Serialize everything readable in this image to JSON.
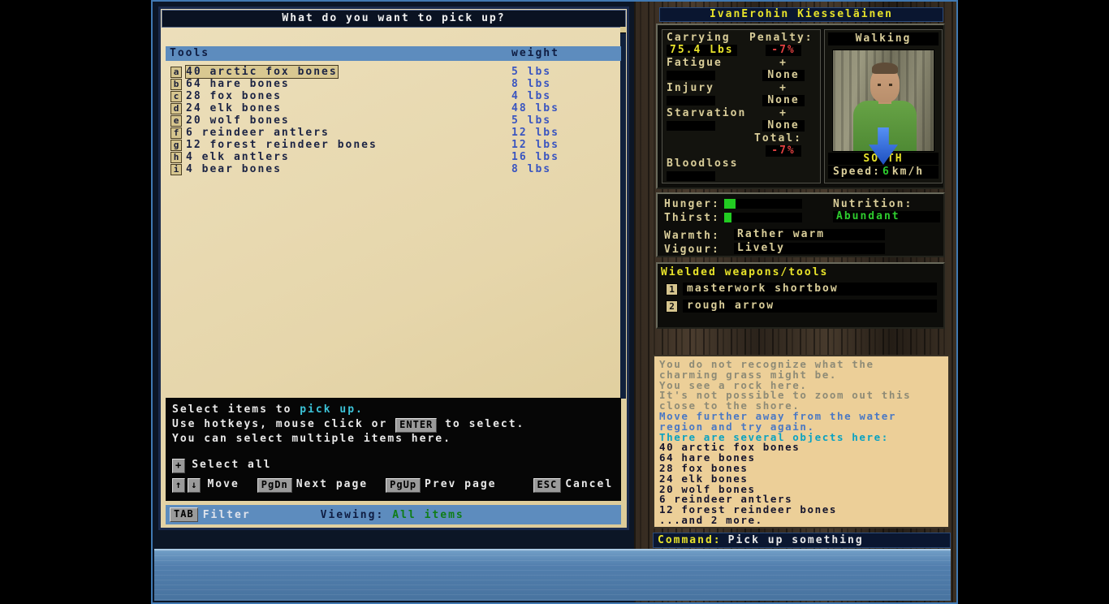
{
  "colors": {
    "header_blue": "#5d8cbe",
    "parchment": "#e6d6ab",
    "weight_blue": "#3a55c0",
    "penalty_red": "#e04040",
    "accent_yellow": "#e8e32a",
    "good_green": "#2ecc2e",
    "highlight_cyan": "#3cc3d8",
    "log_tan": "#eccf98"
  },
  "dialog": {
    "title": "What do you want to pick up?",
    "list_header": {
      "category": "Tools",
      "weight_col": "weight"
    },
    "items": [
      {
        "key": "a",
        "name": "40 arctic fox bones",
        "weight": "5 lbs",
        "selected": true
      },
      {
        "key": "b",
        "name": "64 hare bones",
        "weight": "8 lbs",
        "selected": false
      },
      {
        "key": "c",
        "name": "28 fox bones",
        "weight": "4 lbs",
        "selected": false
      },
      {
        "key": "d",
        "name": "24 elk bones",
        "weight": "48 lbs",
        "selected": false
      },
      {
        "key": "e",
        "name": "20 wolf bones",
        "weight": "5 lbs",
        "selected": false
      },
      {
        "key": "f",
        "name": "6 reindeer antlers",
        "weight": "12 lbs",
        "selected": false
      },
      {
        "key": "g",
        "name": "12 forest reindeer bones",
        "weight": "12 lbs",
        "selected": false
      },
      {
        "key": "h",
        "name": "4 elk antlers",
        "weight": "16 lbs",
        "selected": false
      },
      {
        "key": "i",
        "name": "4 bear bones",
        "weight": "8 lbs",
        "selected": false
      }
    ],
    "help": {
      "line1_prefix": "Select items to ",
      "line1_highlight": "pick up.",
      "line2_prefix": "Use hotkeys, mouse click or ",
      "line2_key": "ENTER",
      "line2_suffix": " to select.",
      "line3": "You can select multiple items here.",
      "select_all_key": "+",
      "select_all_label": "Select all",
      "up_key": "↑",
      "down_key": "↓",
      "move_label": "Move",
      "pgdn_key": "PgDn",
      "pgdn_label": "Next page",
      "pgup_key": "PgUp",
      "pgup_label": "Prev page",
      "esc_key": "ESC",
      "esc_label": "Cancel"
    },
    "filter_bar": {
      "tab_key": "TAB",
      "filter_label": "Filter",
      "viewing_label": "Viewing:",
      "viewing_value": "All items"
    }
  },
  "character": {
    "name": "IvanErohin Kiesseläinen",
    "carrying_label": "Carrying",
    "carrying_value": "75.4 Lbs",
    "penalty_label": "Penalty:",
    "penalty_value": "-7%",
    "fatigue_label": "Fatigue",
    "injury_label": "Injury",
    "starvation_label": "Starvation",
    "bloodloss_label": "Bloodloss",
    "plus": "+",
    "none_value": "None",
    "total_label": "Total:",
    "total_value": "-7%",
    "movement_mode": "Walking",
    "direction": "SOUTH",
    "speed_label": "Speed:",
    "speed_value": "6",
    "speed_unit": "km/h"
  },
  "vitals": {
    "hunger_label": "Hunger:",
    "hunger_fill": 15,
    "thirst_label": "Thirst:",
    "thirst_fill": 9,
    "nutrition_label": "Nutrition:",
    "nutrition_value": "Abundant",
    "warmth_label": "Warmth:",
    "warmth_value": "Rather warm",
    "vigour_label": "Vigour:",
    "vigour_value": "Lively"
  },
  "wielded": {
    "title": "Wielded weapons/tools",
    "slots": [
      {
        "key": "1",
        "name": "masterwork shortbow"
      },
      {
        "key": "2",
        "name": "rough arrow"
      }
    ]
  },
  "log": {
    "lines": [
      {
        "text": "You do not recognize what the",
        "tone": "gray"
      },
      {
        "text": "charming grass might be.",
        "tone": "gray"
      },
      {
        "text": "You see a rock here.",
        "tone": "gray"
      },
      {
        "text": "It's not possible to zoom out this",
        "tone": "gray"
      },
      {
        "text": "close to the shore.",
        "tone": "gray"
      },
      {
        "text": "Move further away from the water",
        "tone": "blue"
      },
      {
        "text": "region and try again.",
        "tone": "blue"
      },
      {
        "text": "There are several objects here:",
        "tone": "cyan"
      },
      {
        "text": "40 arctic fox bones",
        "tone": "dark"
      },
      {
        "text": "64 hare bones",
        "tone": "dark"
      },
      {
        "text": "28 fox bones",
        "tone": "dark"
      },
      {
        "text": "24 elk bones",
        "tone": "dark"
      },
      {
        "text": "20 wolf bones",
        "tone": "dark"
      },
      {
        "text": "6 reindeer antlers",
        "tone": "dark"
      },
      {
        "text": "12 forest reindeer bones",
        "tone": "dark"
      },
      {
        "text": "...and 2 more.",
        "tone": "dark"
      }
    ]
  },
  "command": {
    "label": "Command:",
    "value": "Pick up something"
  }
}
